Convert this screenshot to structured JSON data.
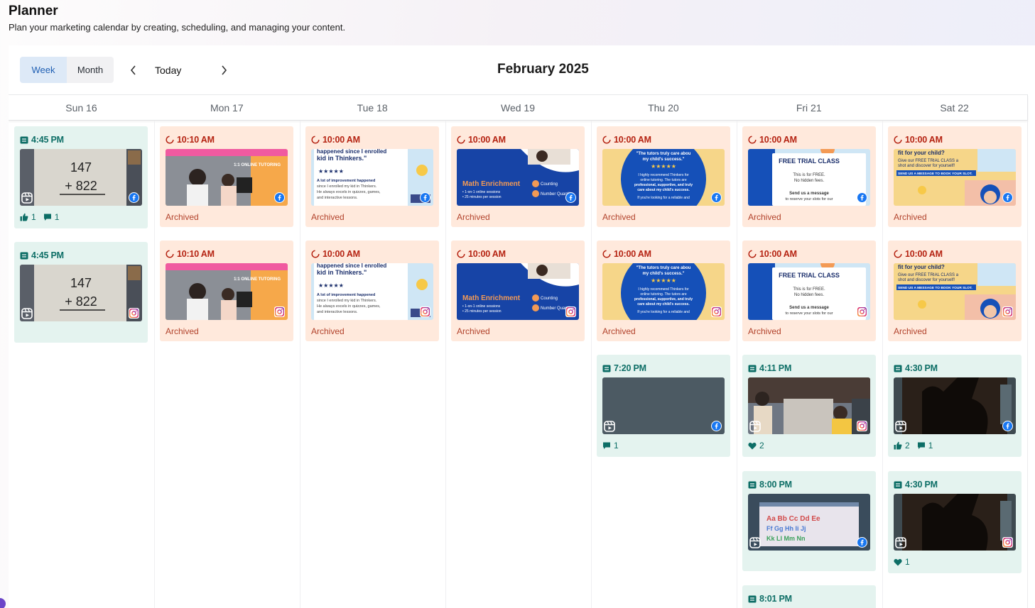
{
  "header": {
    "title": "Planner",
    "subtitle": "Plan your marketing calendar by creating, scheduling, and managing your content."
  },
  "toolbar": {
    "views": [
      "Week",
      "Month"
    ],
    "active_view": "Week",
    "today_label": "Today",
    "month_title": "February 2025"
  },
  "days": [
    "Sun 16",
    "Mon 17",
    "Tue 18",
    "Wed 19",
    "Thu 20",
    "Fri 21",
    "Sat 22"
  ],
  "colors": {
    "published_bg": "#e4f3ef",
    "published_text": "#0d6e66",
    "archived_bg": "#ffe9dc",
    "archived_time": "#b52312",
    "archived_label": "#b2432c",
    "active_view_bg": "#dde9f7",
    "active_view_text": "#1f5fb3"
  },
  "thumb_text": {
    "math_top": "147",
    "math_bottom": "+ 822",
    "tutor_badge": "1:1 ONLINE TUTORING",
    "testimonial_head": "happened since I enrolled my kid in Thinkers.\"",
    "testimonial_sub": "A lot of improvement happened since I enrolled my kid in Thinkers. He always excels in quizzes, games, and interactive lessons.",
    "math_enrichment": "Math Enrichment",
    "enrichment_items": [
      "Counting",
      "Number Quantity"
    ],
    "blue_quote": "\"The tutors truly care about my child's success.\"",
    "trial_title": "FREE TRIAL CLASS",
    "trial_sub": "This is for FREE. No hidden fees.",
    "trial_msg": "Send us a message to reserve your slots for our",
    "fit_title": "fit for your child?",
    "fit_cta": "SEND US A MESSAGE TO BOOK YOUR SLOT."
  },
  "posts": [
    {
      "name": "post-sun-fb",
      "status": "published",
      "time": "4:45 PM",
      "network": "facebook",
      "thumb": "math",
      "likes": "1",
      "comments": "1",
      "loves": ""
    },
    {
      "name": "post-sun-ig",
      "status": "published",
      "time": "4:45 PM",
      "network": "instagram",
      "thumb": "math",
      "likes": "",
      "comments": "",
      "loves": ""
    },
    {
      "name": "post-mon-fb",
      "status": "archived",
      "time": "10:10 AM",
      "network": "facebook",
      "thumb": "tutoring",
      "label": "Archived"
    },
    {
      "name": "post-mon-ig",
      "status": "archived",
      "time": "10:10 AM",
      "network": "instagram",
      "thumb": "tutoring",
      "label": "Archived"
    },
    {
      "name": "post-tue-fb",
      "status": "archived",
      "time": "10:00 AM",
      "network": "facebook",
      "thumb": "testimonial",
      "label": "Archived"
    },
    {
      "name": "post-tue-ig",
      "status": "archived",
      "time": "10:00 AM",
      "network": "instagram",
      "thumb": "testimonial",
      "label": "Archived"
    },
    {
      "name": "post-wed-fb",
      "status": "archived",
      "time": "10:00 AM",
      "network": "facebook",
      "thumb": "enrichment",
      "label": "Archived"
    },
    {
      "name": "post-wed-ig",
      "status": "archived",
      "time": "10:00 AM",
      "network": "instagram",
      "thumb": "enrichment",
      "label": "Archived"
    },
    {
      "name": "post-thu-fb",
      "status": "archived",
      "time": "10:00 AM",
      "network": "facebook",
      "thumb": "bluequote",
      "label": "Archived"
    },
    {
      "name": "post-thu-ig",
      "status": "archived",
      "time": "10:00 AM",
      "network": "instagram",
      "thumb": "bluequote",
      "label": "Archived"
    },
    {
      "name": "post-thu-reel",
      "status": "published",
      "time": "7:20 PM",
      "network": "facebook",
      "thumb": "dark",
      "likes": "",
      "comments": "1",
      "loves": ""
    },
    {
      "name": "post-fri-fb",
      "status": "archived",
      "time": "10:00 AM",
      "network": "facebook",
      "thumb": "trial",
      "label": "Archived"
    },
    {
      "name": "post-fri-ig",
      "status": "archived",
      "time": "10:00 AM",
      "network": "instagram",
      "thumb": "trial",
      "label": "Archived"
    },
    {
      "name": "post-fri-reel-1",
      "status": "published",
      "time": "4:11 PM",
      "network": "instagram",
      "thumb": "kids",
      "likes": "",
      "comments": "",
      "loves": "2"
    },
    {
      "name": "post-fri-reel-2",
      "status": "published",
      "time": "8:00 PM",
      "network": "facebook",
      "thumb": "board",
      "likes": "",
      "comments": "",
      "loves": ""
    },
    {
      "name": "post-fri-reel-3",
      "status": "published",
      "time": "8:01 PM",
      "network": "facebook",
      "thumb": "dark",
      "likes": "",
      "comments": "",
      "loves": ""
    },
    {
      "name": "post-sat-fb",
      "status": "archived",
      "time": "10:00 AM",
      "network": "facebook",
      "thumb": "fit",
      "label": "Archived"
    },
    {
      "name": "post-sat-ig",
      "status": "archived",
      "time": "10:00 AM",
      "network": "instagram",
      "thumb": "fit",
      "label": "Archived"
    },
    {
      "name": "post-sat-reel-fb",
      "status": "published",
      "time": "4:30 PM",
      "network": "facebook",
      "thumb": "silhouette",
      "likes": "2",
      "comments": "1",
      "loves": ""
    },
    {
      "name": "post-sat-reel-ig",
      "status": "published",
      "time": "4:30 PM",
      "network": "instagram",
      "thumb": "silhouette",
      "likes": "",
      "comments": "",
      "loves": "1"
    }
  ]
}
